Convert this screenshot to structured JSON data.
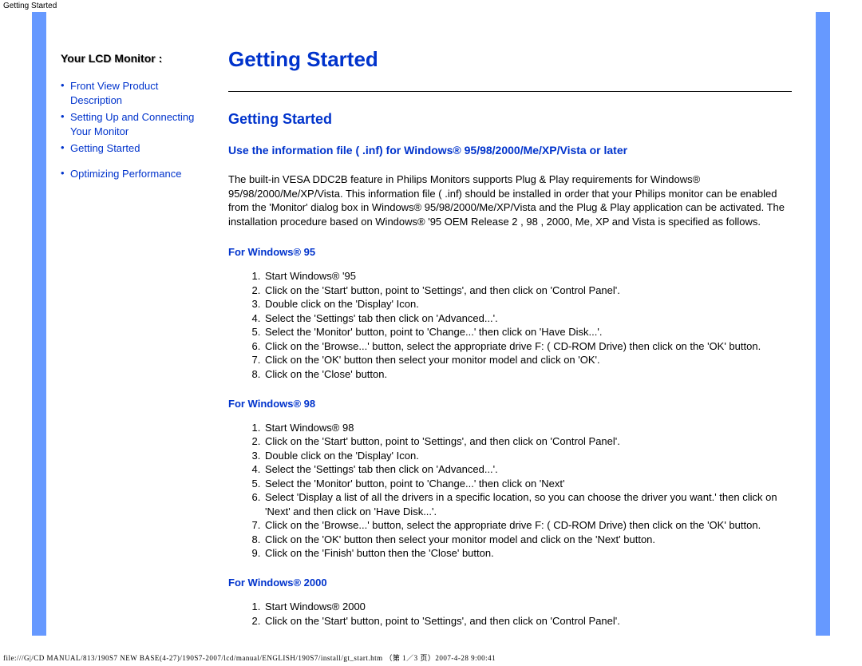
{
  "header_label": "Getting Started",
  "sidebar": {
    "title": "Your LCD Monitor :",
    "items": [
      {
        "label": "Front View Product Description"
      },
      {
        "label": "Setting Up and Connecting Your Monitor"
      },
      {
        "label": "Getting Started"
      }
    ],
    "items2": [
      {
        "label": "Optimizing Performance"
      }
    ]
  },
  "main": {
    "title": "Getting Started",
    "subtitle": "Getting Started",
    "inst_heading": "Use the information file ( .inf) for Windows® 95/98/2000/Me/XP/Vista or later",
    "body": "The built-in VESA DDC2B feature in Philips Monitors supports Plug & Play requirements for Windows® 95/98/2000/Me/XP/Vista. This information file ( .inf) should be installed in order that your Philips monitor can be enabled from the 'Monitor' dialog box in Windows® 95/98/2000/Me/XP/Vista and the Plug & Play application can be activated. The installation procedure based on Windows® '95 OEM Release 2 , 98 , 2000, Me, XP and Vista is specified as follows.",
    "sections": [
      {
        "heading": "For Windows® 95",
        "steps": [
          "Start Windows® '95",
          "Click on the 'Start' button, point to 'Settings', and then click on 'Control Panel'.",
          "Double click on the 'Display' Icon.",
          "Select the 'Settings' tab then click on 'Advanced...'.",
          "Select the 'Monitor' button, point to 'Change...' then click on 'Have Disk...'.",
          "Click on the 'Browse...' button, select the appropriate drive F: ( CD-ROM Drive) then click on the 'OK' button.",
          "Click on the 'OK' button then select your monitor model and click on 'OK'.",
          "Click on the 'Close' button."
        ]
      },
      {
        "heading": "For Windows® 98",
        "steps": [
          "Start Windows® 98",
          "Click on the 'Start' button, point to 'Settings', and then click on 'Control Panel'.",
          "Double click on the 'Display' Icon.",
          "Select the 'Settings' tab then click on 'Advanced...'.",
          "Select the 'Monitor' button, point to 'Change...' then click on 'Next'",
          "Select 'Display a list of all the drivers in a specific location, so you can choose the driver you want.' then click on 'Next' and then click on 'Have Disk...'.",
          "Click on the 'Browse...' button, select the appropriate drive F: ( CD-ROM Drive) then click on the 'OK' button.",
          "Click on the 'OK' button then select your monitor model and click on the 'Next' button.",
          "Click on the 'Finish' button then the 'Close' button."
        ]
      },
      {
        "heading": "For Windows® 2000",
        "steps": [
          "Start Windows® 2000",
          "Click on the 'Start' button, point to 'Settings', and then click on 'Control Panel'."
        ]
      }
    ]
  },
  "footer": "file:///G|/CD MANUAL/813/190S7 NEW BASE(4-27)/190S7-2007/lcd/manual/ENGLISH/190S7/install/gt_start.htm （第 1／3 页）2007-4-28 9:00:41"
}
